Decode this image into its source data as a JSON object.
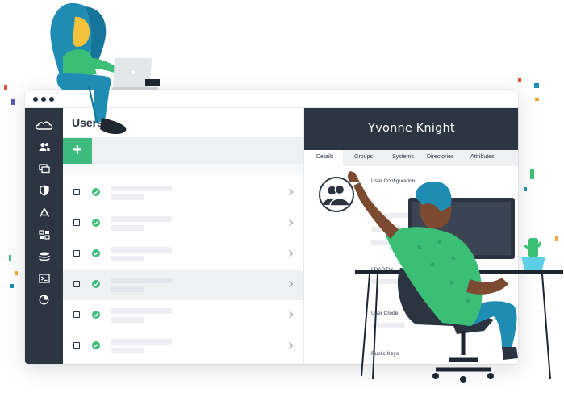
{
  "users_panel": {
    "title": "Users",
    "add_label": "+",
    "rows": [
      {
        "status": "active"
      },
      {
        "status": "active"
      },
      {
        "status": "active"
      },
      {
        "status": "active"
      },
      {
        "status": "active"
      },
      {
        "status": "active"
      }
    ]
  },
  "details_panel": {
    "user_name": "Yvonne Knight",
    "tabs": [
      "Details",
      "Groups",
      "Systems",
      "Directories",
      "Attributes"
    ],
    "active_tab": "Details",
    "sections": {
      "user_config": "User Configuration",
      "ldap": "LDAP Dis",
      "user_creds": "User Crede",
      "public_keys": "Public Keys"
    }
  },
  "sidebar": {
    "icons": [
      "cloud-logo-icon",
      "users-icon",
      "systems-icon",
      "policies-icon",
      "recycle-icon",
      "grid-icon",
      "database-icon",
      "terminal-icon",
      "reports-icon"
    ]
  },
  "colors": {
    "sidebar": "#2c3541",
    "accent_green": "#3dbb7e",
    "row_alt": "#eef0f2",
    "person_teal": "#1f8cb4",
    "person_green": "#3bbf77"
  }
}
